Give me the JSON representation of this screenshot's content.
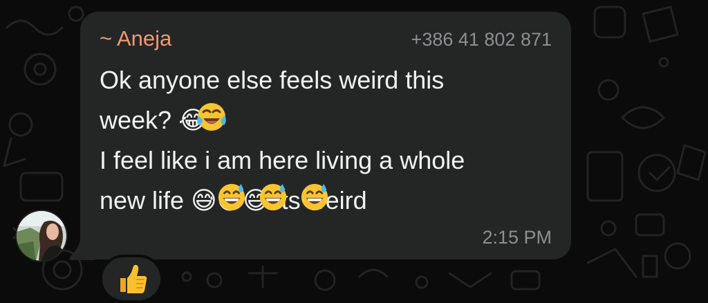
{
  "message": {
    "sender_name": "~ Aneja",
    "sender_phone": "+386 41 802 871",
    "text": "Ok anyone else feels weird this\nweek? 😂\nI feel like i am here living a whole\nnew life 😅😅😅 its weird",
    "time": "2:15 PM"
  },
  "reaction": {
    "icon": "thumbs-up-icon"
  },
  "avatar": {
    "icon": "profile-photo"
  },
  "colors": {
    "background": "#0b0b0b",
    "bubble": "#242626",
    "sender_name": "#f19a73",
    "secondary_text": "#8c9090",
    "message_text": "#f2f2f2"
  }
}
